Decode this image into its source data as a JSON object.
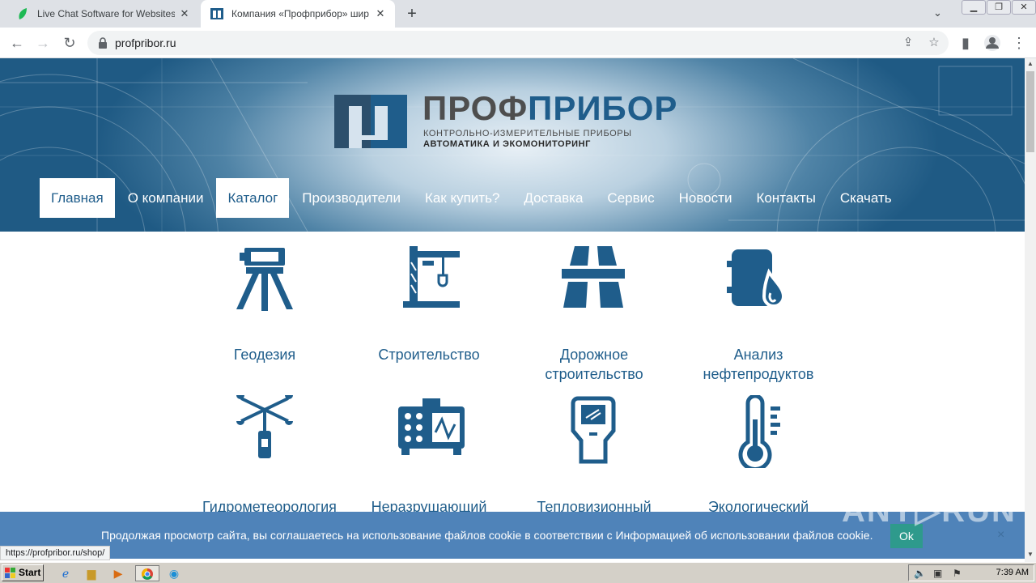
{
  "browser": {
    "tabs": [
      {
        "title": "Live Chat Software for Websites | Ji"
      },
      {
        "title": "Компания «Профприбор» широкий"
      }
    ],
    "new_tab": "+",
    "url": "profpribor.ru",
    "status_url": "https://profpribor.ru/shop/"
  },
  "site": {
    "logo_part1": "ПРОФ",
    "logo_part2": "ПРИБОР",
    "logo_sub1": "КОНТРОЛЬНО-ИЗМЕРИТЕЛЬНЫЕ ПРИБОРЫ",
    "logo_sub2": "АВТОМАТИКА И ЭКОМОНИТОРИНГ",
    "nav": [
      {
        "label": "Главная"
      },
      {
        "label": "О компании"
      },
      {
        "label": "Каталог"
      },
      {
        "label": "Производители"
      },
      {
        "label": "Как купить?"
      },
      {
        "label": "Доставка"
      },
      {
        "label": "Сервис"
      },
      {
        "label": "Новости"
      },
      {
        "label": "Контакты"
      },
      {
        "label": "Скачать"
      }
    ],
    "categories": [
      {
        "line1": "Геодезия",
        "line2": "",
        "icon": "tripod-icon"
      },
      {
        "line1": "Строительство",
        "line2": "",
        "icon": "crane-icon"
      },
      {
        "line1": "Дорожное",
        "line2": "строительство",
        "icon": "road-icon"
      },
      {
        "line1": "Анализ",
        "line2": "нефтепродуктов",
        "icon": "oil-barrel-icon"
      },
      {
        "line1": "Гидрометеорология",
        "line2": "",
        "icon": "anemometer-icon"
      },
      {
        "line1": "Неразрушающий",
        "line2": "",
        "icon": "flaw-detector-icon"
      },
      {
        "line1": "Тепловизионный",
        "line2": "",
        "icon": "thermal-imager-icon"
      },
      {
        "line1": "Экологический",
        "line2": "",
        "icon": "thermometer-icon"
      }
    ]
  },
  "cookie": {
    "text": "Продолжая просмотр сайта, вы соглашаетесь на использование файлов cookie в соответствии с Информацией об использовании файлов cookie.",
    "ok": "Ok",
    "close": "×"
  },
  "watermark": "ANY▷RUN",
  "taskbar": {
    "start": "Start",
    "time": "7:39 AM"
  },
  "colors": {
    "brand": "#1f5d8b",
    "cookie_bar": "#4f83b9",
    "ok_button": "#2e9a8c"
  }
}
